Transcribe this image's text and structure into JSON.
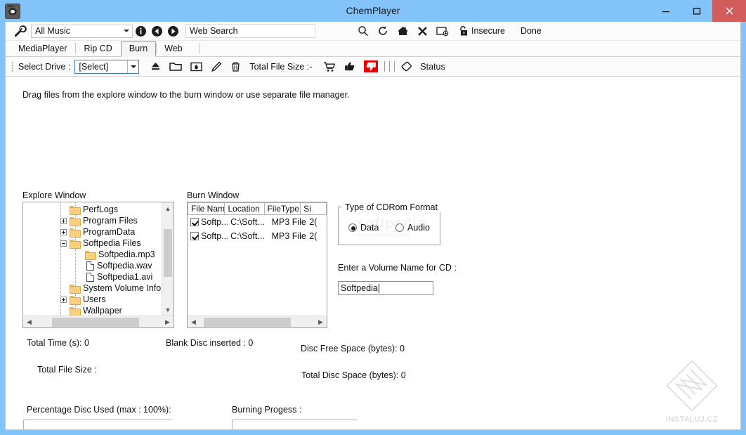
{
  "window": {
    "title": "ChemPlayer",
    "app_icon": "camera-icon",
    "minimize": "minimize-icon",
    "maximize": "maximize-icon",
    "close": "close-icon",
    "titlebar_color": "#82c3fa",
    "close_color": "#d35c5c"
  },
  "navbar": {
    "wrench_icon": "wrench-icon",
    "library_combo": "All Music",
    "info_icon": "info-icon",
    "back_icon": "back-arrow-icon",
    "forward_icon": "forward-arrow-icon",
    "search_value": "Web Search",
    "search_placeholder": "Web Search",
    "icons": [
      {
        "name": "search-icon",
        "label": ""
      },
      {
        "name": "refresh-icon",
        "label": ""
      },
      {
        "name": "home-icon",
        "label": ""
      },
      {
        "name": "stop-icon",
        "label": ""
      },
      {
        "name": "add-folder-icon",
        "label": ""
      },
      {
        "name": "unlock-icon",
        "label": "Insecure"
      }
    ],
    "status_label": "Done"
  },
  "tabs": [
    {
      "label": "MediaPlayer",
      "active": false
    },
    {
      "label": "Rip CD",
      "active": false
    },
    {
      "label": "Burn",
      "active": true
    },
    {
      "label": "Web",
      "active": false
    }
  ],
  "toolbar": {
    "select_drive_label": "Select Drive :",
    "drive_value": "[Select]",
    "total_file_size_label": "Total File Size :-",
    "status_label": "Status",
    "icons": [
      "eject-icon",
      "open-folder-icon",
      "burn-folder-icon",
      "pencil-icon",
      "trash-icon",
      "cart-icon",
      "thumbs-up-icon",
      "thumbs-down-icon",
      "eraser-icon"
    ],
    "hot_icon_color": "#e60000"
  },
  "main": {
    "hint": "Drag files from the explore window to the burn window or use separate file manager.",
    "explore_label": "Explore Window",
    "burn_label": "Burn Window",
    "tree": [
      {
        "label": "PerfLogs",
        "depth": 2,
        "icon": "folder-icon",
        "expander": "none"
      },
      {
        "label": "Program Files",
        "depth": 2,
        "icon": "folder-icon",
        "expander": "plus"
      },
      {
        "label": "ProgramData",
        "depth": 2,
        "icon": "folder-icon",
        "expander": "plus"
      },
      {
        "label": "Softpedia Files",
        "depth": 2,
        "icon": "folder-icon",
        "expander": "minus"
      },
      {
        "label": "Softpedia.mp3",
        "depth": 3,
        "icon": "folder-icon",
        "expander": "none"
      },
      {
        "label": "Softpedia.wav",
        "depth": 3,
        "icon": "file-icon",
        "expander": "none"
      },
      {
        "label": "Softpedia1.avi",
        "depth": 3,
        "icon": "file-icon",
        "expander": "none"
      },
      {
        "label": "System Volume Informatic",
        "depth": 2,
        "icon": "folder-icon",
        "expander": "none"
      },
      {
        "label": "Users",
        "depth": 2,
        "icon": "folder-icon",
        "expander": "plus"
      },
      {
        "label": "Wallpaper",
        "depth": 2,
        "icon": "folder-icon",
        "expander": "none"
      }
    ],
    "burn_columns": [
      "File Name",
      "Location",
      "FileType",
      "Si"
    ],
    "burn_rows": [
      {
        "checked": true,
        "file_name": "Softp...",
        "location": "C:\\Soft...",
        "file_type": "MP3 File",
        "size": "2("
      },
      {
        "checked": true,
        "file_name": "Softp...",
        "location": "C:\\Soft...",
        "file_type": "MP3 File",
        "size": "2("
      }
    ],
    "cdrom_group_title": "Type of CDRom Format",
    "cdrom_options": [
      {
        "label": "Data",
        "selected": true
      },
      {
        "label": "Audio",
        "selected": false
      }
    ],
    "volume_label": "Enter a Volume Name for CD :",
    "volume_value": "Softpedia",
    "stats": {
      "total_time": "Total Time (s): 0",
      "blank_disc": "Blank Disc inserted :  0",
      "disc_free_space": "Disc Free Space (bytes): 0",
      "total_file_size": "Total File Size :",
      "total_disc_space": "Total Disc Space (bytes): 0"
    },
    "percentage_label": "Percentage Disc Used  (max : 100%):",
    "burning_label": "Burning Progess  :"
  },
  "watermark": {
    "text": "INSTALUJ.CZ",
    "overlay": "softpedia",
    "overlay_sub": "www.softpedia.com"
  }
}
